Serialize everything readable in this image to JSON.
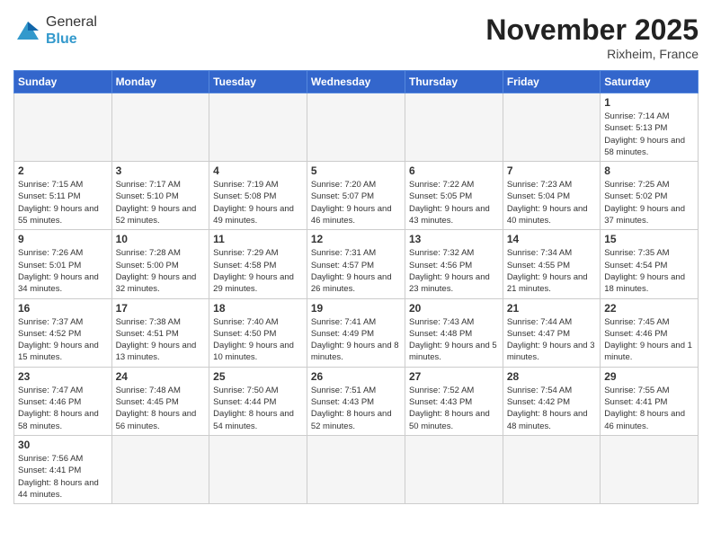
{
  "logo": {
    "text_general": "General",
    "text_blue": "Blue"
  },
  "title": "November 2025",
  "location": "Rixheim, France",
  "days_of_week": [
    "Sunday",
    "Monday",
    "Tuesday",
    "Wednesday",
    "Thursday",
    "Friday",
    "Saturday"
  ],
  "weeks": [
    [
      {
        "day": "",
        "empty": true
      },
      {
        "day": "",
        "empty": true
      },
      {
        "day": "",
        "empty": true
      },
      {
        "day": "",
        "empty": true
      },
      {
        "day": "",
        "empty": true
      },
      {
        "day": "",
        "empty": true
      },
      {
        "day": "1",
        "sunrise": "7:14 AM",
        "sunset": "5:13 PM",
        "daylight": "9 hours and 58 minutes."
      }
    ],
    [
      {
        "day": "2",
        "sunrise": "7:15 AM",
        "sunset": "5:11 PM",
        "daylight": "9 hours and 55 minutes."
      },
      {
        "day": "3",
        "sunrise": "7:17 AM",
        "sunset": "5:10 PM",
        "daylight": "9 hours and 52 minutes."
      },
      {
        "day": "4",
        "sunrise": "7:19 AM",
        "sunset": "5:08 PM",
        "daylight": "9 hours and 49 minutes."
      },
      {
        "day": "5",
        "sunrise": "7:20 AM",
        "sunset": "5:07 PM",
        "daylight": "9 hours and 46 minutes."
      },
      {
        "day": "6",
        "sunrise": "7:22 AM",
        "sunset": "5:05 PM",
        "daylight": "9 hours and 43 minutes."
      },
      {
        "day": "7",
        "sunrise": "7:23 AM",
        "sunset": "5:04 PM",
        "daylight": "9 hours and 40 minutes."
      },
      {
        "day": "8",
        "sunrise": "7:25 AM",
        "sunset": "5:02 PM",
        "daylight": "9 hours and 37 minutes."
      }
    ],
    [
      {
        "day": "9",
        "sunrise": "7:26 AM",
        "sunset": "5:01 PM",
        "daylight": "9 hours and 34 minutes."
      },
      {
        "day": "10",
        "sunrise": "7:28 AM",
        "sunset": "5:00 PM",
        "daylight": "9 hours and 32 minutes."
      },
      {
        "day": "11",
        "sunrise": "7:29 AM",
        "sunset": "4:58 PM",
        "daylight": "9 hours and 29 minutes."
      },
      {
        "day": "12",
        "sunrise": "7:31 AM",
        "sunset": "4:57 PM",
        "daylight": "9 hours and 26 minutes."
      },
      {
        "day": "13",
        "sunrise": "7:32 AM",
        "sunset": "4:56 PM",
        "daylight": "9 hours and 23 minutes."
      },
      {
        "day": "14",
        "sunrise": "7:34 AM",
        "sunset": "4:55 PM",
        "daylight": "9 hours and 21 minutes."
      },
      {
        "day": "15",
        "sunrise": "7:35 AM",
        "sunset": "4:54 PM",
        "daylight": "9 hours and 18 minutes."
      }
    ],
    [
      {
        "day": "16",
        "sunrise": "7:37 AM",
        "sunset": "4:52 PM",
        "daylight": "9 hours and 15 minutes."
      },
      {
        "day": "17",
        "sunrise": "7:38 AM",
        "sunset": "4:51 PM",
        "daylight": "9 hours and 13 minutes."
      },
      {
        "day": "18",
        "sunrise": "7:40 AM",
        "sunset": "4:50 PM",
        "daylight": "9 hours and 10 minutes."
      },
      {
        "day": "19",
        "sunrise": "7:41 AM",
        "sunset": "4:49 PM",
        "daylight": "9 hours and 8 minutes."
      },
      {
        "day": "20",
        "sunrise": "7:43 AM",
        "sunset": "4:48 PM",
        "daylight": "9 hours and 5 minutes."
      },
      {
        "day": "21",
        "sunrise": "7:44 AM",
        "sunset": "4:47 PM",
        "daylight": "9 hours and 3 minutes."
      },
      {
        "day": "22",
        "sunrise": "7:45 AM",
        "sunset": "4:46 PM",
        "daylight": "9 hours and 1 minute."
      }
    ],
    [
      {
        "day": "23",
        "sunrise": "7:47 AM",
        "sunset": "4:46 PM",
        "daylight": "8 hours and 58 minutes."
      },
      {
        "day": "24",
        "sunrise": "7:48 AM",
        "sunset": "4:45 PM",
        "daylight": "8 hours and 56 minutes."
      },
      {
        "day": "25",
        "sunrise": "7:50 AM",
        "sunset": "4:44 PM",
        "daylight": "8 hours and 54 minutes."
      },
      {
        "day": "26",
        "sunrise": "7:51 AM",
        "sunset": "4:43 PM",
        "daylight": "8 hours and 52 minutes."
      },
      {
        "day": "27",
        "sunrise": "7:52 AM",
        "sunset": "4:43 PM",
        "daylight": "8 hours and 50 minutes."
      },
      {
        "day": "28",
        "sunrise": "7:54 AM",
        "sunset": "4:42 PM",
        "daylight": "8 hours and 48 minutes."
      },
      {
        "day": "29",
        "sunrise": "7:55 AM",
        "sunset": "4:41 PM",
        "daylight": "8 hours and 46 minutes."
      }
    ],
    [
      {
        "day": "30",
        "sunrise": "7:56 AM",
        "sunset": "4:41 PM",
        "daylight": "8 hours and 44 minutes."
      },
      {
        "day": "",
        "empty": true
      },
      {
        "day": "",
        "empty": true
      },
      {
        "day": "",
        "empty": true
      },
      {
        "day": "",
        "empty": true
      },
      {
        "day": "",
        "empty": true
      },
      {
        "day": "",
        "empty": true
      }
    ]
  ]
}
